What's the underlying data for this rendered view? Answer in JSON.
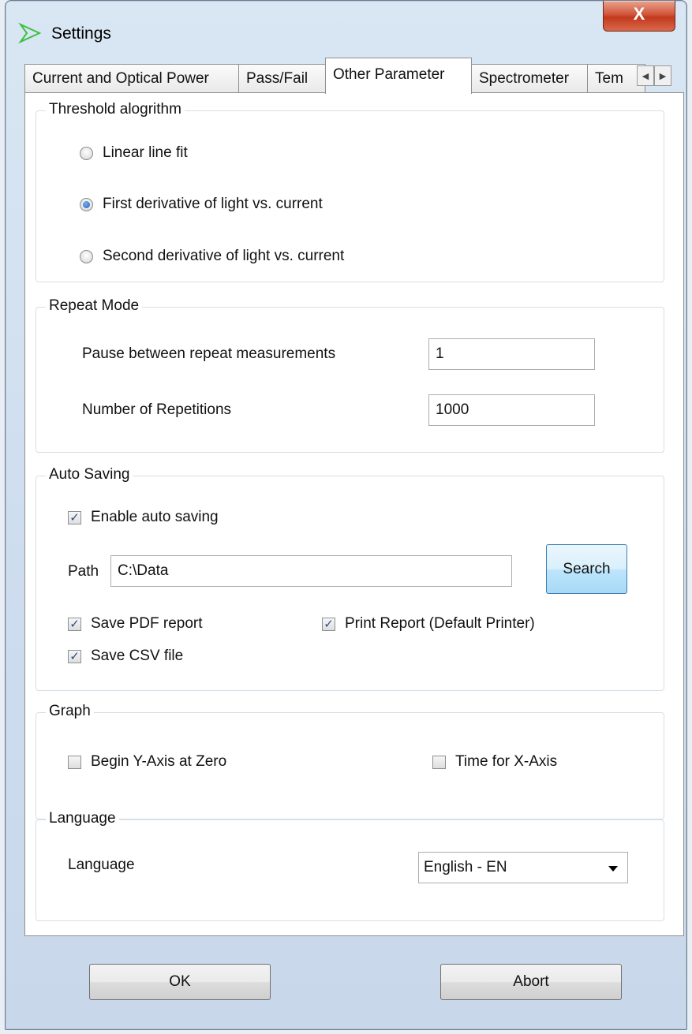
{
  "window": {
    "title": "Settings",
    "close_label": "X"
  },
  "tabs": [
    {
      "label": "Current and Optical Power"
    },
    {
      "label": "Pass/Fail"
    },
    {
      "label": "Other Parameter"
    },
    {
      "label": "Spectrometer"
    },
    {
      "label": "Tem"
    }
  ],
  "threshold": {
    "title": "Threshold alogrithm",
    "options": [
      {
        "label": "Linear line fit",
        "checked": false
      },
      {
        "label": "First derivative of light vs. current",
        "checked": true
      },
      {
        "label": "Second derivative of light vs. current",
        "checked": false
      }
    ]
  },
  "repeat": {
    "title": "Repeat Mode",
    "pause_label": "Pause between repeat measurements",
    "pause_value": "1",
    "reps_label": "Number of Repetitions",
    "reps_value": "1000"
  },
  "autosave": {
    "title": "Auto Saving",
    "enable_label": "Enable auto saving",
    "enable_checked": true,
    "path_label": "Path",
    "path_value": "C:\\Data",
    "search_label": "Search",
    "pdf_label": "Save PDF report",
    "pdf_checked": true,
    "print_label": "Print Report (Default Printer)",
    "print_checked": true,
    "csv_label": "Save CSV file",
    "csv_checked": true
  },
  "graph": {
    "title": "Graph",
    "yzero_label": "Begin Y-Axis at Zero",
    "yzero_checked": false,
    "time_label": "Time for X-Axis",
    "time_checked": false
  },
  "language": {
    "title": "Language",
    "label": "Language",
    "selected": "English - EN"
  },
  "buttons": {
    "ok": "OK",
    "abort": "Abort"
  },
  "icons": {
    "app": "arrow-logo-icon",
    "tab_left": "chevron-left-icon",
    "tab_right": "chevron-right-icon",
    "dropdown": "chevron-down-icon"
  },
  "colors": {
    "app_icon": "#3fbf3f",
    "close_button": "#c8452a",
    "focus_button": "#3c7fb1"
  }
}
